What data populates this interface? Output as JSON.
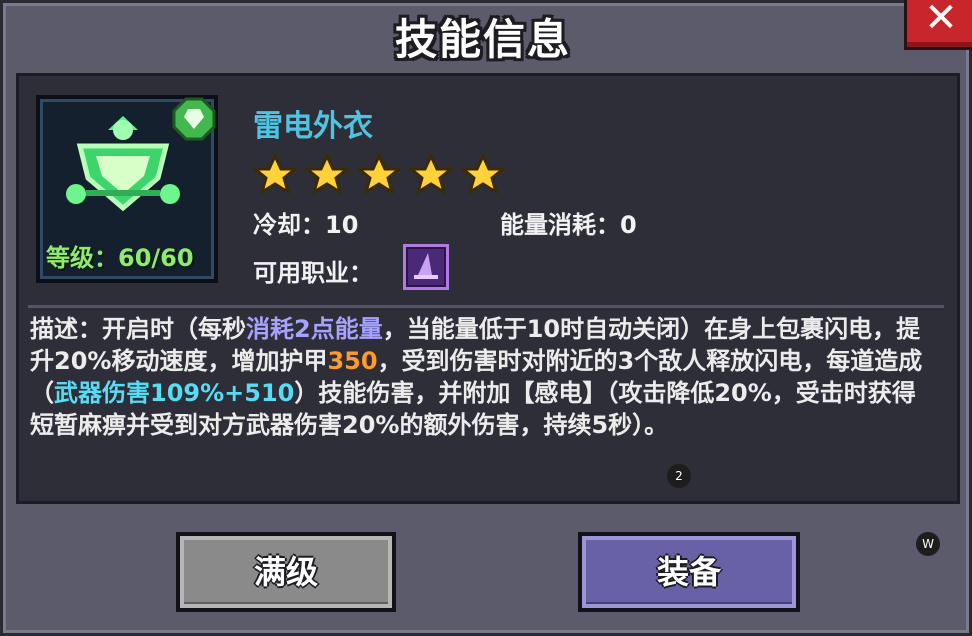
{
  "window": {
    "title": "技能信息",
    "close_label": "✕"
  },
  "skill": {
    "name": "雷电外衣",
    "level_text": "等级：60/60",
    "stars": 5,
    "cooldown_label": "冷却：",
    "cooldown_value": "10",
    "energy_label": "能量消耗：",
    "energy_value": "0",
    "class_label": "可用职业：",
    "class_icon": "wizard-hat-icon"
  },
  "description": {
    "p1": "描述：开启时（每秒",
    "h1": "消耗2点能量",
    "p2": "，当能量低于10时自动关闭）在身上包裹闪电，提升20%移动速度，增加护甲",
    "h2": "350",
    "p3": "，受到伤害时对附近的3个敌人释放闪电，每道造成（",
    "h3": "武器伤害109%+510",
    "p4": "）技能伤害，并附加【感电】（攻击降低20%，受击时获得短暂麻痹并受到对方武器伤害20%的额外伤害，持续5秒）。"
  },
  "badges": {
    "page": "2",
    "w": "W"
  },
  "buttons": {
    "max_level": "满级",
    "equip": "装备"
  },
  "colors": {
    "name": "#4fc3df",
    "level": "#8eeb6e",
    "highlight_purple": "#a6a2ff",
    "highlight_orange": "#ff9a2e",
    "highlight_cyan": "#58dcf3"
  }
}
